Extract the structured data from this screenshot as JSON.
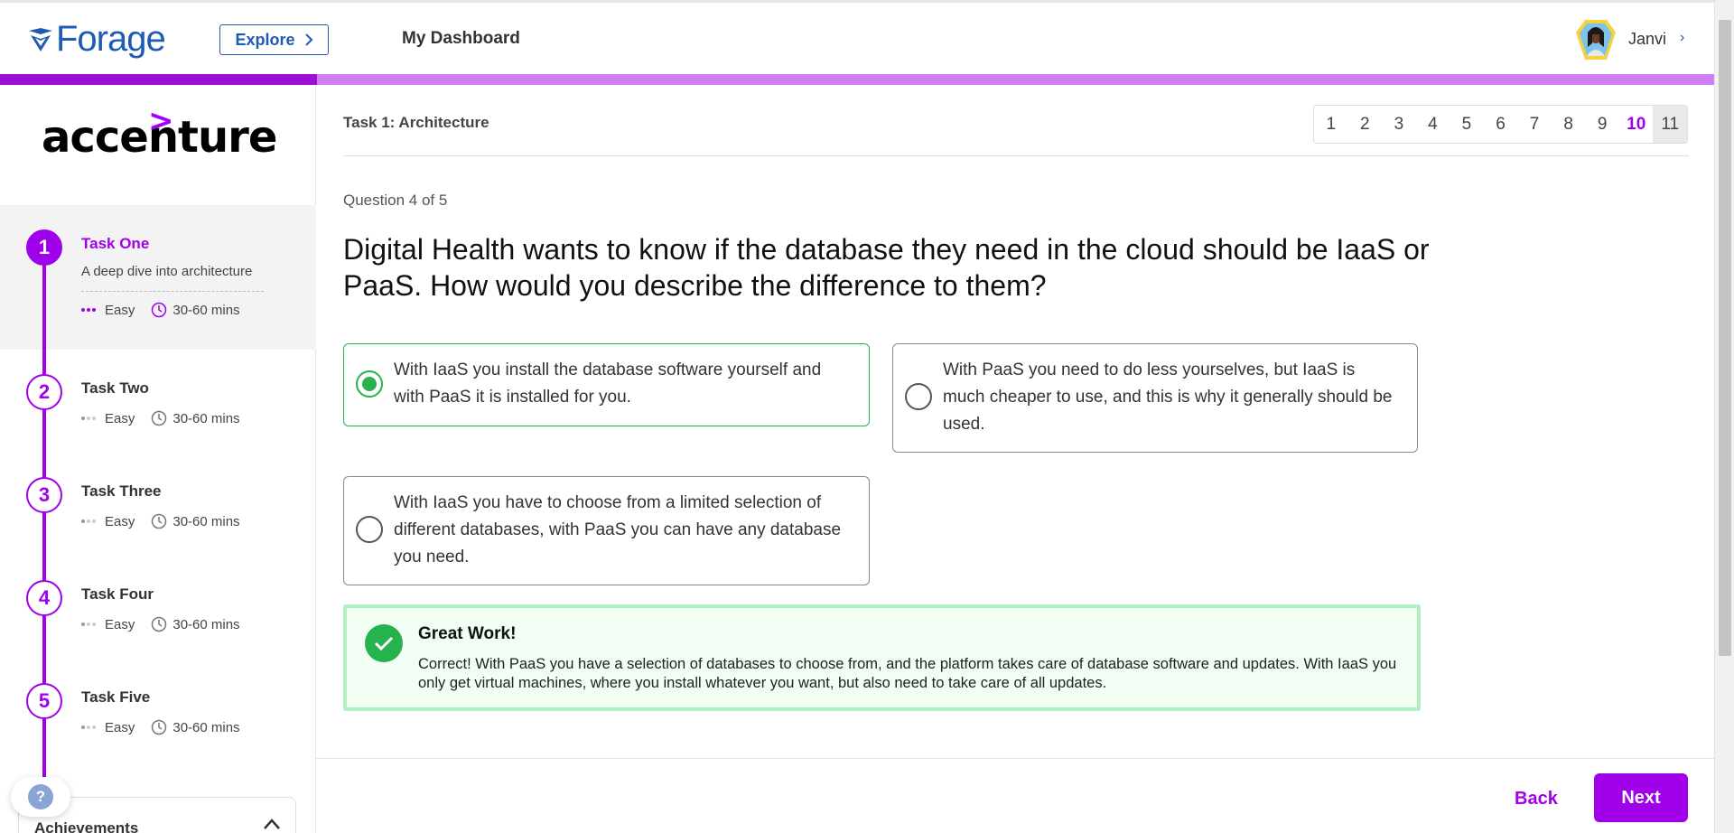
{
  "header": {
    "logo_text": "Forage",
    "explore_label": "Explore",
    "dashboard_label": "My Dashboard",
    "user_name": "Janvi",
    "user_chevron": "›"
  },
  "progress": {
    "fraction": 0.185
  },
  "colors": {
    "brand_blue": "#1f5bb5",
    "accent_purple": "#a000ea",
    "progress_light": "#d07ff5",
    "correct_green": "#26b24c",
    "feedback_bg": "#f2fdf4"
  },
  "sidebar": {
    "company": "accenture",
    "company_mark": ">",
    "tasks": [
      {
        "number": "1",
        "title": "Task One",
        "subtitle": "A deep dive into architecture",
        "difficulty": "Easy",
        "duration": "30-60 mins",
        "active": true
      },
      {
        "number": "2",
        "title": "Task Two",
        "difficulty": "Easy",
        "duration": "30-60 mins",
        "active": false
      },
      {
        "number": "3",
        "title": "Task Three",
        "difficulty": "Easy",
        "duration": "30-60 mins",
        "active": false
      },
      {
        "number": "4",
        "title": "Task Four",
        "difficulty": "Easy",
        "duration": "30-60 mins",
        "active": false
      },
      {
        "number": "5",
        "title": "Task Five",
        "difficulty": "Easy",
        "duration": "30-60 mins",
        "active": false
      }
    ],
    "help_label": "?",
    "achievements_label": "Achievements"
  },
  "main": {
    "task_header": "Task 1: Architecture",
    "pages": [
      "1",
      "2",
      "3",
      "4",
      "5",
      "6",
      "7",
      "8",
      "9",
      "10",
      "11"
    ],
    "current_page": "10",
    "question_counter": "Question 4 of 5",
    "question": "Digital Health wants to know if the database they need in the cloud should be IaaS or PaaS. How would you describe the difference to them?",
    "options": [
      {
        "text": "With IaaS you install the database software yourself and with PaaS it is installed for you.",
        "selected": true
      },
      {
        "text": "With PaaS you need to do less yourselves, but IaaS is much cheaper to use, and this is why it generally should be used.",
        "selected": false
      },
      {
        "text": "With IaaS you have to choose from a limited selection of different databases, with PaaS you can have any database you need.",
        "selected": false
      }
    ],
    "feedback": {
      "title": "Great Work!",
      "body": "Correct! With PaaS you have a selection of databases to choose from, and the platform takes care of database software and updates. With IaaS you only get virtual machines, where you install whatever you want, but also need to take care of all updates."
    },
    "back_label": "Back",
    "next_label": "Next"
  }
}
